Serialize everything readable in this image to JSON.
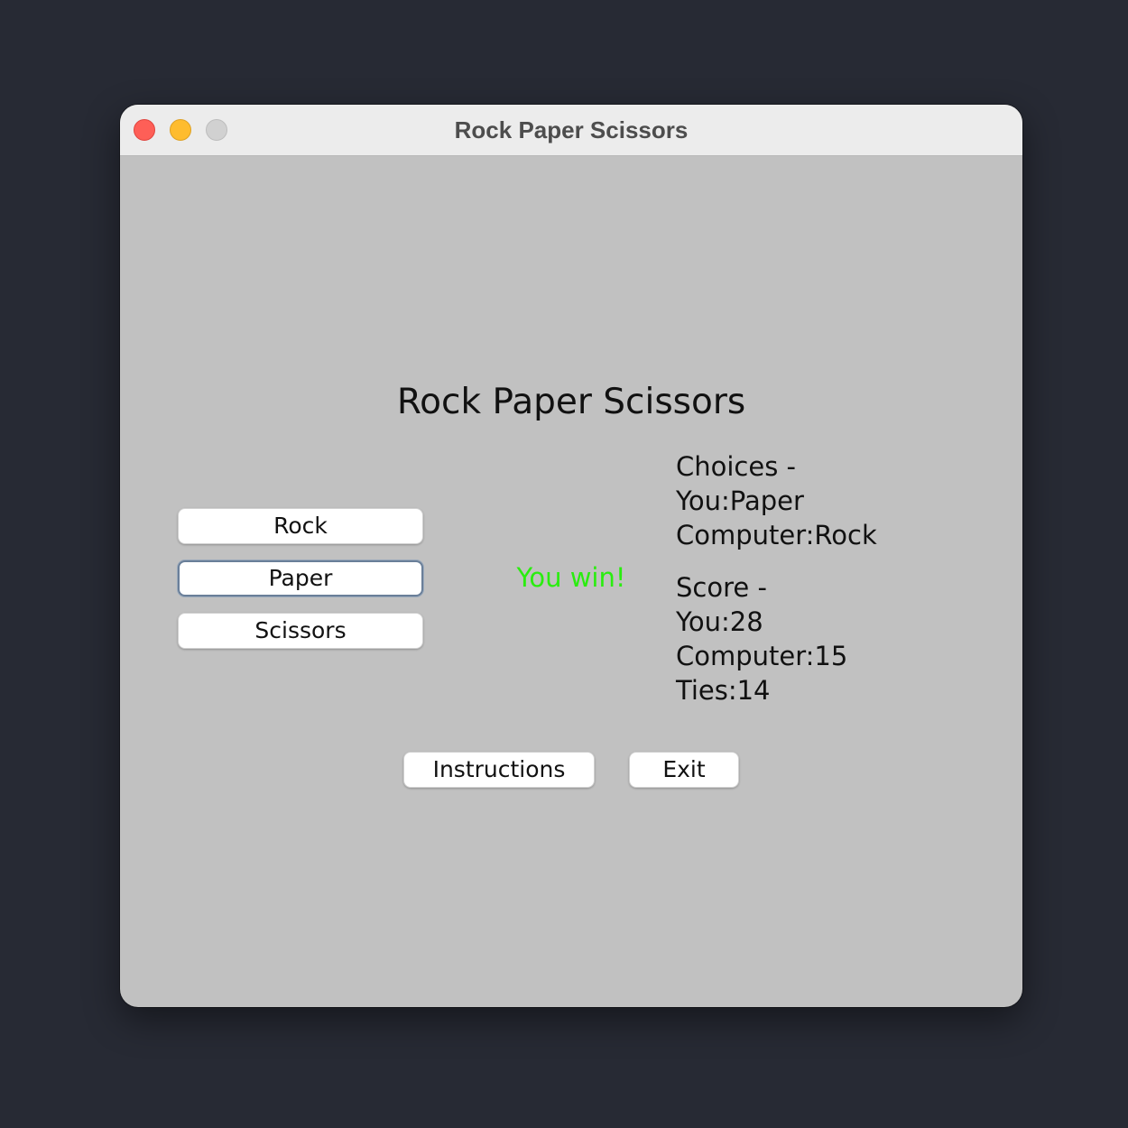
{
  "window": {
    "title": "Rock Paper Scissors"
  },
  "game": {
    "heading": "Rock Paper Scissors",
    "buttons": {
      "rock": "Rock",
      "paper": "Paper",
      "scissors": "Scissors",
      "instructions": "Instructions",
      "exit": "Exit"
    },
    "result": "You win!",
    "choices": {
      "header": "Choices -",
      "you": "You:Paper",
      "computer": "Computer:Rock"
    },
    "score": {
      "header": "Score -",
      "you": "You:28",
      "computer": "Computer:15",
      "ties": "Ties:14"
    }
  },
  "colors": {
    "result_text": "#2aed0f",
    "window_background": "#c1c1c1",
    "desktop_background": "#272a34"
  }
}
